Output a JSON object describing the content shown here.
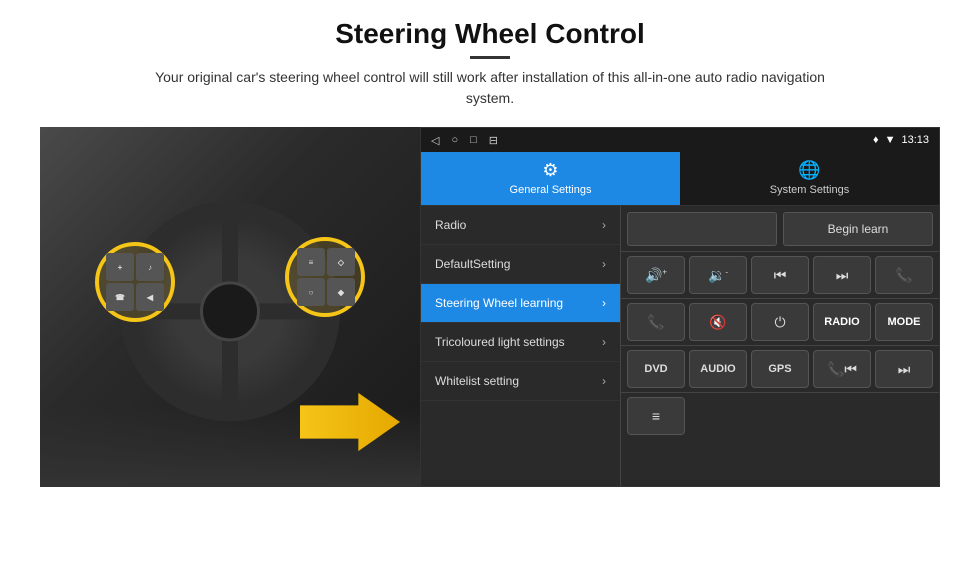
{
  "header": {
    "title": "Steering Wheel Control",
    "subtitle": "Your original car's steering wheel control will still work after installation of this all-in-one auto radio navigation system."
  },
  "status_bar": {
    "time": "13:13",
    "icons": [
      "◁",
      "○",
      "□",
      "⊟"
    ],
    "right_icons": [
      "♦",
      "▼"
    ]
  },
  "tabs": [
    {
      "id": "general",
      "label": "General Settings",
      "icon": "⚙",
      "active": true
    },
    {
      "id": "system",
      "label": "System Settings",
      "icon": "🌐",
      "active": false
    }
  ],
  "menu_items": [
    {
      "id": "radio",
      "label": "Radio",
      "active": false
    },
    {
      "id": "default",
      "label": "DefaultSetting",
      "active": false
    },
    {
      "id": "steering",
      "label": "Steering Wheel learning",
      "active": true
    },
    {
      "id": "tricoloured",
      "label": "Tricoloured light settings",
      "active": false
    },
    {
      "id": "whitelist",
      "label": "Whitelist setting",
      "active": false
    }
  ],
  "panel": {
    "begin_learn_label": "Begin learn",
    "control_row1": [
      {
        "id": "vol_up",
        "icon": "🔊+",
        "type": "icon"
      },
      {
        "id": "vol_down",
        "icon": "🔉-",
        "type": "icon"
      },
      {
        "id": "prev_track",
        "icon": "⏮",
        "type": "icon"
      },
      {
        "id": "next_track",
        "icon": "⏭",
        "type": "icon"
      },
      {
        "id": "phone",
        "icon": "📞",
        "type": "icon"
      }
    ],
    "control_row2": [
      {
        "id": "call_accept",
        "icon": "📞",
        "type": "icon"
      },
      {
        "id": "mute",
        "icon": "🔇",
        "type": "icon"
      },
      {
        "id": "power",
        "icon": "⏻",
        "type": "icon"
      },
      {
        "id": "radio_btn",
        "label": "RADIO",
        "type": "text"
      },
      {
        "id": "mode_btn",
        "label": "MODE",
        "type": "text"
      }
    ],
    "control_row3": [
      {
        "id": "dvd",
        "label": "DVD",
        "type": "text"
      },
      {
        "id": "audio",
        "label": "AUDIO",
        "type": "text"
      },
      {
        "id": "gps",
        "label": "GPS",
        "type": "text"
      },
      {
        "id": "phone2",
        "icon": "📞⏮",
        "type": "icon"
      },
      {
        "id": "combo",
        "icon": "⏭",
        "type": "icon"
      }
    ],
    "control_row4": [
      {
        "id": "list_icon",
        "icon": "≡",
        "type": "icon"
      }
    ]
  }
}
